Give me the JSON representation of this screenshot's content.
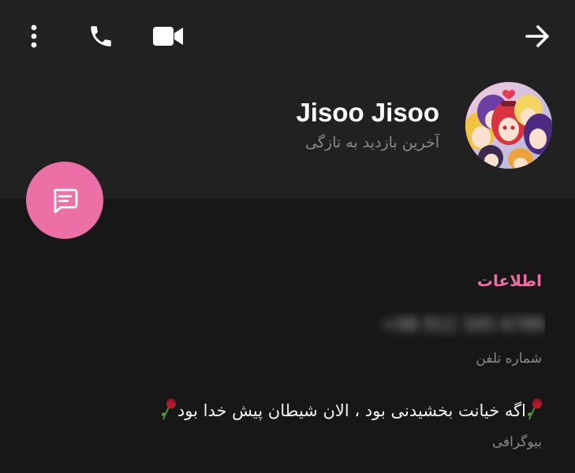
{
  "toolbar": {
    "icons": {
      "more": "more-vertical-icon",
      "call": "phone-icon",
      "video": "video-camera-icon",
      "forward": "arrow-right-icon"
    }
  },
  "profile": {
    "name": "Jisoo Jisoo",
    "status": "آخرین بازدید به تازگی",
    "avatar_icon": "anime-group-avatar"
  },
  "fab": {
    "icon": "message-icon",
    "color": "#ec6fa5"
  },
  "info": {
    "section_title": "اطلاعات",
    "phone_value": "+98 912 345 6789",
    "phone_label": "شماره تلفن",
    "bio_text": "اگه خیانت بخشیدنی بود ، الان شیطان پیش خدا بود",
    "bio_emoji": "wilted-rose-icon",
    "bio_label": "بیوگرافی"
  },
  "colors": {
    "accent": "#ec6fa5",
    "header_bg": "#212121",
    "body_bg": "#171717",
    "secondary_text": "#8a8a8a"
  }
}
